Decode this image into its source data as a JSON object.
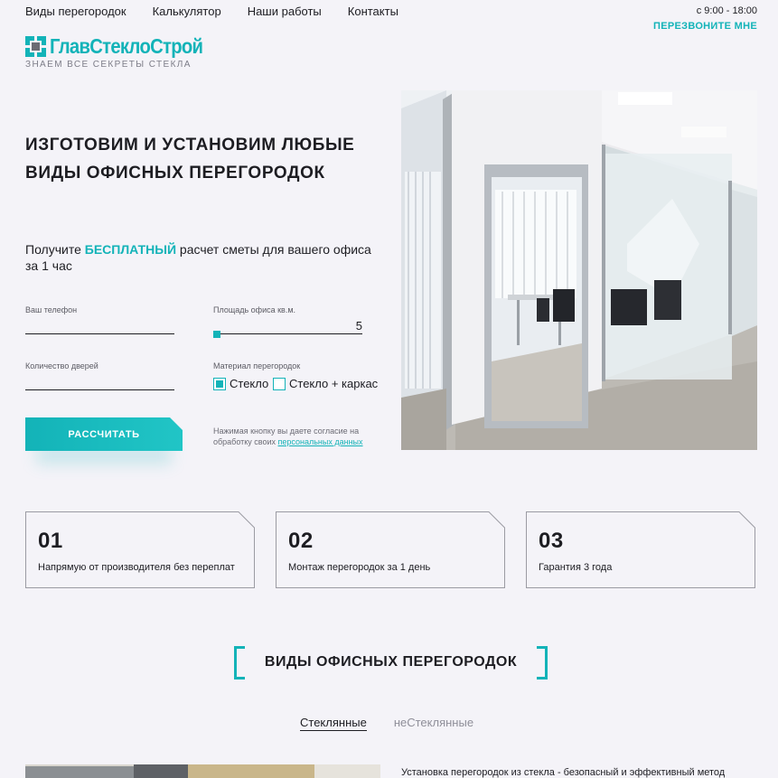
{
  "nav": [
    "Виды перегородок",
    "Калькулятор",
    "Наши работы",
    "Контакты"
  ],
  "header": {
    "hours": "с 9:00 - 18:00",
    "callback": "ПЕРЕЗВОНИТЕ МНЕ"
  },
  "logo": {
    "name": "ГлавСтеклоСтрой",
    "tagline": "ЗНАЕМ ВСЕ СЕКРЕТЫ СТЕКЛА"
  },
  "hero": {
    "title": "ИЗГОТОВИМ И УСТАНОВИМ ЛЮБЫЕ ВИДЫ ОФИСНЫХ ПЕРЕГОРОДОК",
    "sub_before": "Получите ",
    "sub_bold": "БЕСПЛАТНЫЙ",
    "sub_after": " расчет сметы для вашего офиса за 1 час"
  },
  "form": {
    "phone_label": "Ваш телефон",
    "area_label": "Площадь офиса кв.м.",
    "area_value": "5",
    "doors_label": "Количество дверей",
    "material_label": "Материал перегородок",
    "option_glass": "Стекло",
    "option_glass_frame": "Стекло + каркас",
    "button": "РАССЧИТАТЬ",
    "consent_text": "Нажимая кнопку вы даете согласие на обработку своих ",
    "consent_link": "персональных данных"
  },
  "features": [
    {
      "num": "01",
      "text": "Напрямую от производителя без переплат"
    },
    {
      "num": "02",
      "text": "Монтаж перегородок за 1 день"
    },
    {
      "num": "03",
      "text": "Гарантия 3 года"
    }
  ],
  "section": {
    "title": "ВИДЫ ОФИСНЫХ ПЕРЕГОРОДОК",
    "tab_active": "Стеклянные",
    "tab_inactive": "неСтеклянные",
    "intro": "Установка перегородок из стекла - безопасный и эффективный метод"
  },
  "colors": {
    "accent": "#13b3b8",
    "background": "#f4f3f8",
    "text": "#1d1d22"
  }
}
